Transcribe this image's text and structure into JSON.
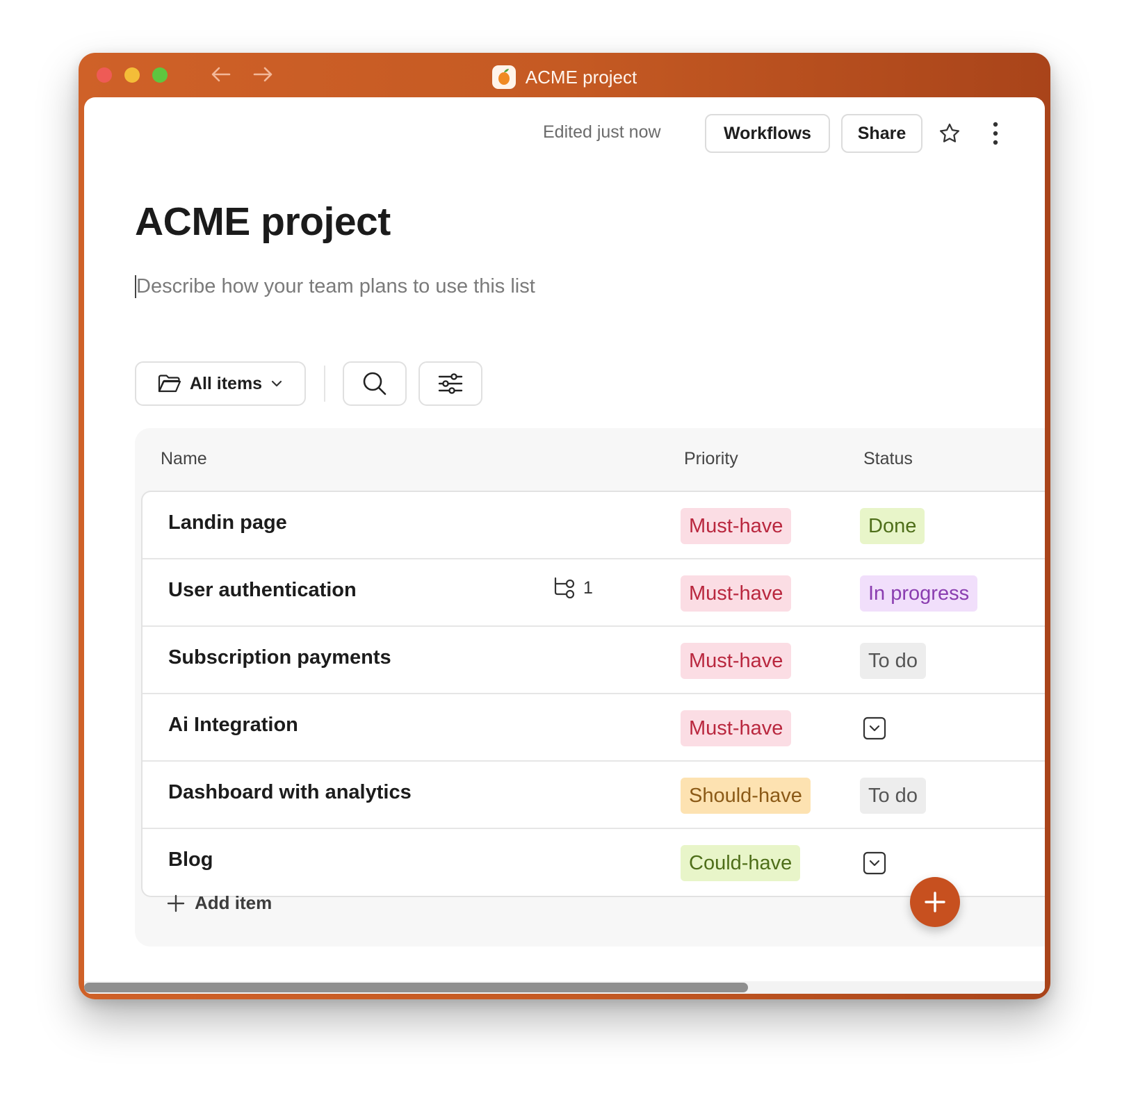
{
  "window": {
    "title": "ACME project",
    "app_icon": "mango-app-icon"
  },
  "header": {
    "edited": "Edited just now",
    "workflows_label": "Workflows",
    "share_label": "Share"
  },
  "page": {
    "title": "ACME project",
    "description_placeholder": "Describe how your team plans to use this list"
  },
  "toolbar": {
    "view_label": "All items"
  },
  "table": {
    "columns": [
      "Name",
      "Priority",
      "Status"
    ],
    "rows": [
      {
        "name": "Landin page",
        "priority": "Must-have",
        "status": "Done"
      },
      {
        "name": "User authentication",
        "subtasks": "1",
        "priority": "Must-have",
        "status": "In progress"
      },
      {
        "name": "Subscription payments",
        "priority": "Must-have",
        "status": "To do"
      },
      {
        "name": "Ai Integration",
        "priority": "Must-have",
        "status": ""
      },
      {
        "name": "Dashboard with analytics",
        "priority": "Should-have",
        "status": "To do"
      },
      {
        "name": "Blog",
        "priority": "Could-have",
        "status": ""
      }
    ],
    "add_item_label": "Add item"
  },
  "colors": {
    "accent": "#c7501f",
    "titlebar": "#c55a23"
  }
}
